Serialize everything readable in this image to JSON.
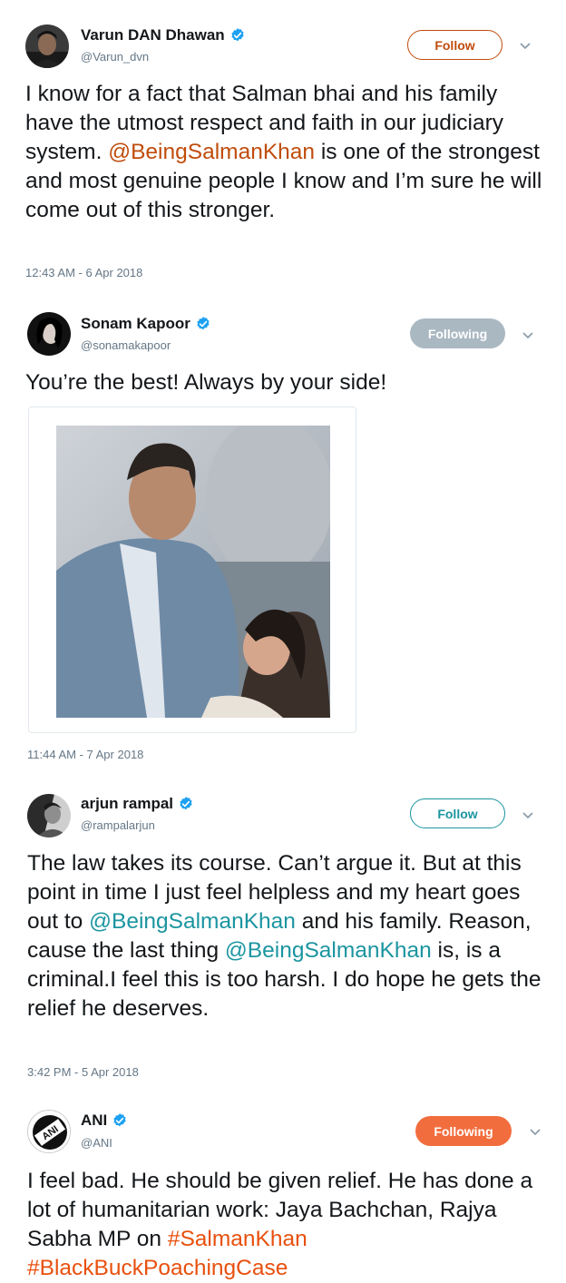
{
  "tweets": [
    {
      "name": "Varun DAN Dhawan",
      "handle": "@Varun_dvn",
      "button": "Follow",
      "text": [
        {
          "t": "I know for a fact that Salman bhai and his family have the utmost respect and faith in our judiciary system. "
        },
        {
          "t": "@BeingSalmanKhan",
          "c": "mention-orange"
        },
        {
          "t": " is one of the strongest and most genuine people  I know and I’m sure he will come out of this stronger."
        }
      ],
      "time": "12:43 AM - 6 Apr 2018"
    },
    {
      "name": "Sonam Kapoor",
      "handle": "@sonamakapoor",
      "button": "Following",
      "text": [
        {
          "t": "You’re the best! Always by your side!"
        }
      ],
      "time": "11:44 AM - 7 Apr 2018"
    },
    {
      "name": "arjun rampal",
      "handle": "@rampalarjun",
      "button": "Follow",
      "text": [
        {
          "t": "The law takes its course. Can’t argue it. But at this point in time I just feel helpless and my heart goes out to "
        },
        {
          "t": "@BeingSalmanKhan",
          "c": "mention-teal"
        },
        {
          "t": " and his family. Reason, cause the last thing "
        },
        {
          "t": "@BeingSalmanKhan",
          "c": "mention-teal"
        },
        {
          "t": " is, is a criminal.I feel this is too harsh. I do hope he gets the relief he deserves."
        }
      ],
      "time": "3:42 PM - 5 Apr 2018"
    },
    {
      "name": "ANI",
      "handle": "@ANI",
      "button": "Following",
      "text": [
        {
          "t": "I feel bad. He should be given relief. He has done a lot of humanitarian work: Jaya Bachchan, Rajya Sabha MP on "
        },
        {
          "t": "#SalmanKhan",
          "c": "hash-orange"
        },
        {
          "t": " "
        },
        {
          "t": "#BlackBuckPoachingCase",
          "c": "hash-orange"
        }
      ]
    }
  ],
  "colors": {
    "verified": "#1da1f2",
    "follow_orange": "#c04c0c",
    "follow_teal": "#1b95a0",
    "following_gray": "#aab8c2",
    "following_orange": "#f26d3d"
  },
  "icons": [
    "verified-badge-icon",
    "chevron-down-icon"
  ]
}
